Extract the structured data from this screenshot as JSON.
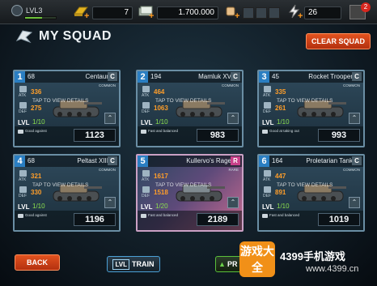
{
  "topbar": {
    "level": "LVL3",
    "xp_fraction": 0.55,
    "gold": "7",
    "cash": "1.700.000",
    "energy": "26",
    "mail_count": "2"
  },
  "header": {
    "title": "MY SQUAD",
    "clear_label": "CLEAR SQUAD"
  },
  "cards": [
    {
      "slot": "1",
      "power": "68",
      "name": "Centaur",
      "grade": "C",
      "rarity": "COMMON",
      "atk": "336",
      "def": "275",
      "level": "1/10",
      "skill": "Good against",
      "score": "1123",
      "tap": "TAP TO VIEW DETAILS",
      "rare": false
    },
    {
      "slot": "2",
      "power": "194",
      "name": "Mamluk XV",
      "grade": "C",
      "rarity": "COMMON",
      "atk": "464",
      "def": "1063",
      "level": "1/10",
      "skill": "Fast and balanced",
      "score": "983",
      "tap": "TAP TO VIEW DETAILS",
      "rare": false
    },
    {
      "slot": "3",
      "power": "45",
      "name": "Rocket Trooper",
      "grade": "C",
      "rarity": "COMMON",
      "atk": "335",
      "def": "261",
      "level": "1/10",
      "skill": "Good at taking out",
      "score": "993",
      "tap": "TAP TO VIEW DETAILS",
      "rare": false
    },
    {
      "slot": "4",
      "power": "68",
      "name": "Peltast XIII",
      "grade": "C",
      "rarity": "COMMON",
      "atk": "321",
      "def": "330",
      "level": "1/10",
      "skill": "Good against",
      "score": "1196",
      "tap": "TAP TO VIEW DETAILS",
      "rare": false
    },
    {
      "slot": "5",
      "power": "",
      "name": "Kullervo's Rage",
      "grade": "R",
      "rarity": "RARE",
      "atk": "1617",
      "def": "1518",
      "level": "1/20",
      "skill": "Fast and balanced",
      "score": "2189",
      "tap": "TAP TO VIEW DETAILS",
      "rare": true
    },
    {
      "slot": "6",
      "power": "164",
      "name": "Proletarian Tank",
      "grade": "C",
      "rarity": "COMMON",
      "atk": "447",
      "def": "891",
      "level": "1/10",
      "skill": "Fast and balanced",
      "score": "1019",
      "tap": "TAP TO VIEW DETAILS",
      "rare": false
    }
  ],
  "labels": {
    "atk": "ATK",
    "def": "DEF",
    "lvl": "LVL"
  },
  "footer": {
    "back_label": "BACK",
    "train_lvl": "LVL",
    "train_label": "TRAIN",
    "pr_label": "PR"
  },
  "watermark": {
    "badge": "游戏大全",
    "text": "4399手机游戏",
    "url": "www.4399.cn"
  }
}
